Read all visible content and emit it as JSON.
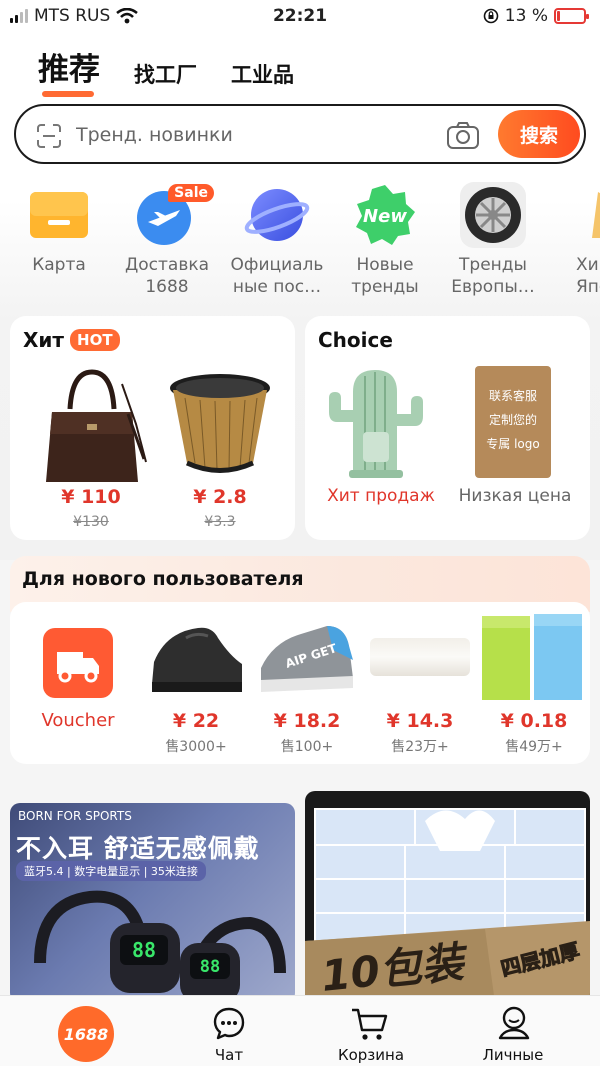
{
  "status_bar": {
    "carrier": "MTS RUS",
    "time": "22:21",
    "battery": "13 %",
    "battery_level": 0.13
  },
  "tabs": [
    {
      "label": "推荐",
      "active": true
    },
    {
      "label": "找工厂",
      "active": false
    },
    {
      "label": "工业品",
      "active": false
    }
  ],
  "search": {
    "placeholder": "Тренд. новинки",
    "button": "搜索"
  },
  "categories": [
    {
      "label": "Карта",
      "icon": "card-icon"
    },
    {
      "label": "Доставка\n1688",
      "icon": "plane-icon",
      "badge": "Sale"
    },
    {
      "label": "Официаль\nные пос…",
      "icon": "planet-icon"
    },
    {
      "label": "Новые\nтренды",
      "icon": "new-badge-icon",
      "badge": "New"
    },
    {
      "label": "Тренды\nЕвропы…",
      "icon": "tire-icon"
    },
    {
      "label": "Хи\nЯпон",
      "icon": "partial-icon"
    }
  ],
  "hit_card": {
    "title": "Хит",
    "badge": "HOT",
    "items": [
      {
        "name": "handbag",
        "price": "¥ 110",
        "old_price": "¥130"
      },
      {
        "name": "coffee-filter",
        "price": "¥ 2.8",
        "old_price": "¥3.3"
      }
    ]
  },
  "choice_card": {
    "title": "Choice",
    "items": [
      {
        "label": "Хит продаж",
        "color": "#e0362b"
      },
      {
        "label": "Низкая цена",
        "color": "#666666",
        "box_text": "联系客服\n定制您的\n专属 logo"
      }
    ]
  },
  "new_user": {
    "title": "Для нового пользователя",
    "voucher_label": "Voucher",
    "products": [
      {
        "name": "shoe-black",
        "price": "¥ 22",
        "sold": "售3000+"
      },
      {
        "name": "shoe-grey",
        "price": "¥ 18.2",
        "sold": "售100+"
      },
      {
        "name": "roller",
        "price": "¥ 14.3",
        "sold": "售23万+"
      },
      {
        "name": "bags",
        "price": "¥ 0.18",
        "sold": "售49万+"
      }
    ]
  },
  "banners": {
    "left": {
      "tag": "BORN FOR SPORTS",
      "headline": "不入耳 舒适无感佩戴",
      "sub": "蓝牙5.4 | 数字电量显示 | 35米连接",
      "digits": "88"
    },
    "right": {
      "big": "10包装",
      "side": "四层加厚"
    }
  },
  "bottom_nav": [
    {
      "label": "",
      "logo": "1688"
    },
    {
      "label": "Чат"
    },
    {
      "label": "Корзина"
    },
    {
      "label": "Личные"
    }
  ],
  "colors": {
    "accent": "#ff6a33",
    "price": "#e0362b"
  }
}
